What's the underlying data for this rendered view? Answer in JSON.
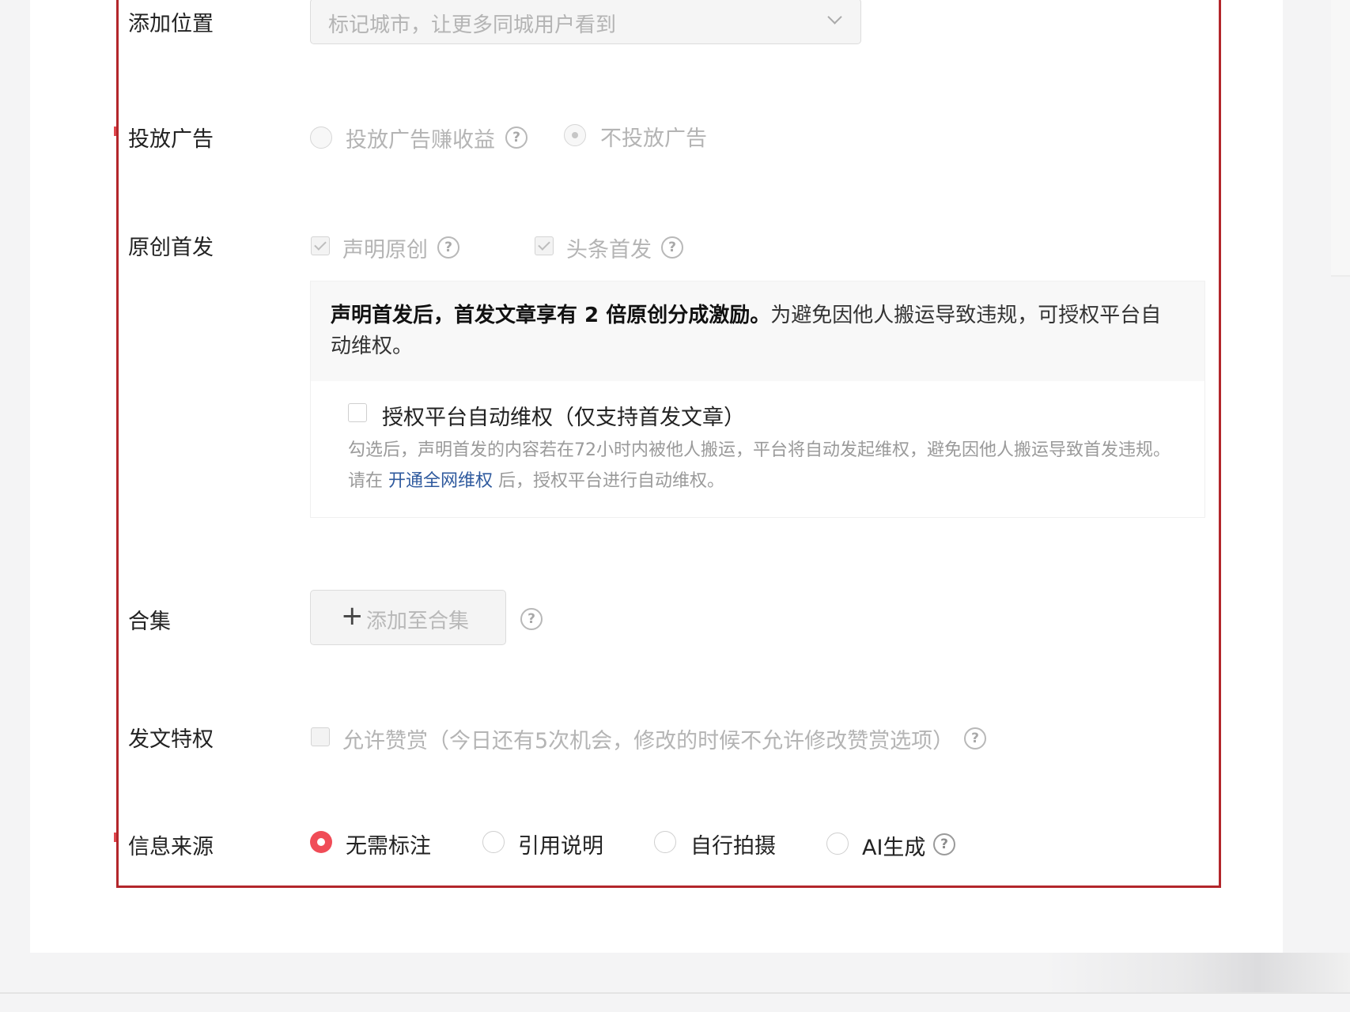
{
  "location": {
    "label": "添加位置",
    "placeholder": "标记城市，让更多同城用户看到",
    "icon": "chevron-down-icon"
  },
  "ads": {
    "label": "投放广告",
    "options": [
      {
        "label": "投放广告赚收益",
        "selected": false,
        "disabled": true
      },
      {
        "label": "不投放广告",
        "selected": true,
        "disabled": true
      }
    ]
  },
  "original": {
    "label": "原创首发",
    "checks": [
      {
        "label": "声明原创",
        "checked": true,
        "disabled": true
      },
      {
        "label": "头条首发",
        "checked": true,
        "disabled": true
      }
    ],
    "info_bold": "声明首发后，首发文章享有 2 倍原创分成激励。",
    "info_rest": "为避免因他人搬运导致违规，可授权平台自动维权。",
    "auth_label": "授权平台自动维权（仅支持首发文章）",
    "auth_desc_pre": "勾选后，声明首发的内容若在72小时内被他人搬运，平台将自动发起维权，避免因他人搬运导致首发违规。请在 ",
    "auth_desc_link": "开通全网维权",
    "auth_desc_post": " 后，授权平台进行自动维权。"
  },
  "collection": {
    "label": "合集",
    "button_plus": "+",
    "button_label": "添加至合集"
  },
  "privilege": {
    "label": "发文特权",
    "option": "允许赞赏（今日还有5次机会，修改的时候不允许修改赞赏选项）"
  },
  "source": {
    "label": "信息来源",
    "options": [
      {
        "label": "无需标注",
        "selected": true
      },
      {
        "label": "引用说明",
        "selected": false
      },
      {
        "label": "自行拍摄",
        "selected": false
      },
      {
        "label": "AI生成",
        "selected": false
      }
    ]
  },
  "help_glyph": "?",
  "colors": {
    "frame": "#b3262b",
    "radio_active": "#f04c57",
    "link": "#2f5a9e"
  }
}
